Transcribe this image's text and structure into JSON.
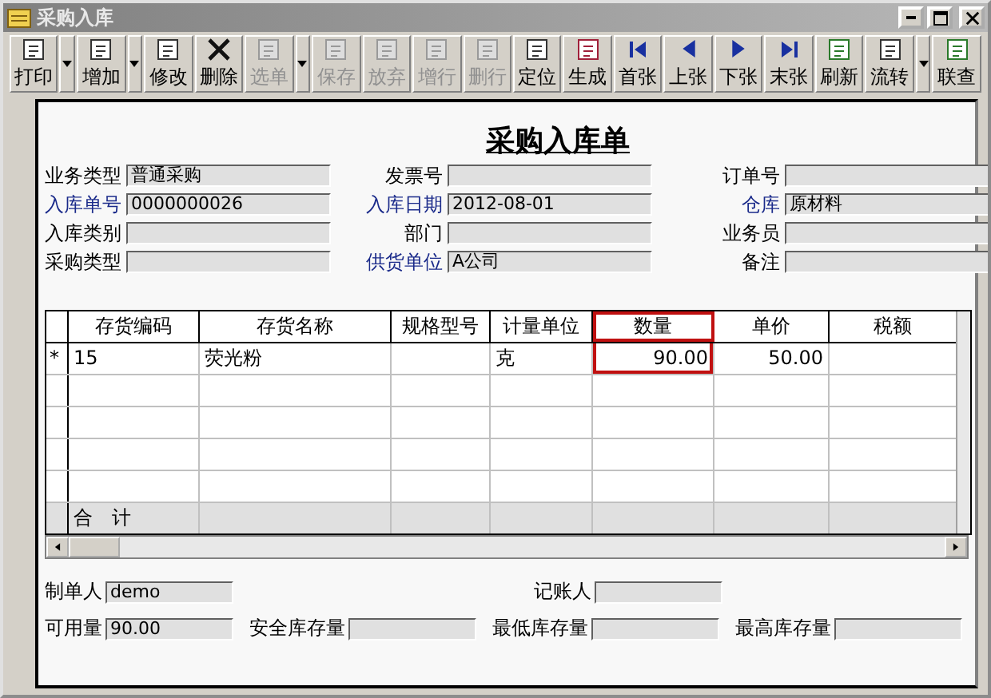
{
  "window": {
    "title": "采购入库"
  },
  "toolbar": [
    {
      "label": "打印",
      "disabled": false,
      "dropdown": true
    },
    {
      "label": "增加",
      "disabled": false,
      "dropdown": true
    },
    {
      "label": "修改",
      "disabled": false,
      "dropdown": false
    },
    {
      "label": "删除",
      "disabled": false,
      "dropdown": false
    },
    {
      "label": "选单",
      "disabled": true,
      "dropdown": true
    },
    {
      "label": "保存",
      "disabled": true,
      "dropdown": false
    },
    {
      "label": "放弃",
      "disabled": true,
      "dropdown": false
    },
    {
      "label": "增行",
      "disabled": true,
      "dropdown": false
    },
    {
      "label": "删行",
      "disabled": true,
      "dropdown": false
    },
    {
      "label": "定位",
      "disabled": false,
      "dropdown": false
    },
    {
      "label": "生成",
      "disabled": false,
      "dropdown": false
    },
    {
      "label": "首张",
      "disabled": false,
      "dropdown": false
    },
    {
      "label": "上张",
      "disabled": false,
      "dropdown": false
    },
    {
      "label": "下张",
      "disabled": false,
      "dropdown": false
    },
    {
      "label": "末张",
      "disabled": false,
      "dropdown": false
    },
    {
      "label": "刷新",
      "disabled": false,
      "dropdown": false
    },
    {
      "label": "流转",
      "disabled": false,
      "dropdown": true
    },
    {
      "label": "联查",
      "disabled": false,
      "dropdown": false
    }
  ],
  "form": {
    "title": "采购入库单",
    "columns": [
      [
        {
          "label": "业务类型",
          "value": "普通采购",
          "required": false
        },
        {
          "label": "入库单号",
          "value": "0000000026",
          "required": true
        },
        {
          "label": "入库类别",
          "required": false
        },
        {
          "label": "采购类型",
          "required": false
        }
      ],
      [
        {
          "label": "发票号",
          "required": false
        },
        {
          "label": "入库日期",
          "value": "2012-08-01",
          "required": true
        },
        {
          "label": "部门",
          "required": false
        },
        {
          "label": "供货单位",
          "value": "A公司",
          "required": true
        }
      ],
      [
        {
          "label": "订单号",
          "required": false
        },
        {
          "label": "仓库",
          "value": "原材料",
          "required": true
        },
        {
          "label": "业务员",
          "required": false
        },
        {
          "label": "备注",
          "required": false
        }
      ]
    ]
  },
  "table": {
    "columns": [
      {
        "label": "存货编码",
        "highlighted": false
      },
      {
        "label": "存货名称",
        "highlighted": false
      },
      {
        "label": "规格型号",
        "highlighted": false
      },
      {
        "label": "计量单位",
        "highlighted": false
      },
      {
        "label": "数量",
        "highlighted": true
      },
      {
        "label": "单价",
        "highlighted": false
      },
      {
        "label": "税额",
        "highlighted": false
      }
    ],
    "rows": [
      {
        "marker": "*",
        "cells": [
          "15",
          "荧光粉",
          null,
          "克",
          "90.00",
          "50.00",
          null
        ]
      }
    ],
    "total_label": "合　计"
  },
  "footer": [
    [
      {
        "label": "制单人",
        "value": "demo"
      },
      {
        "label": "记账人"
      }
    ],
    [
      {
        "label": "可用量",
        "value": "90.00"
      },
      {
        "label": "安全库存量"
      },
      {
        "label": "最低库存量"
      },
      {
        "label": "最高库存量"
      }
    ]
  ]
}
